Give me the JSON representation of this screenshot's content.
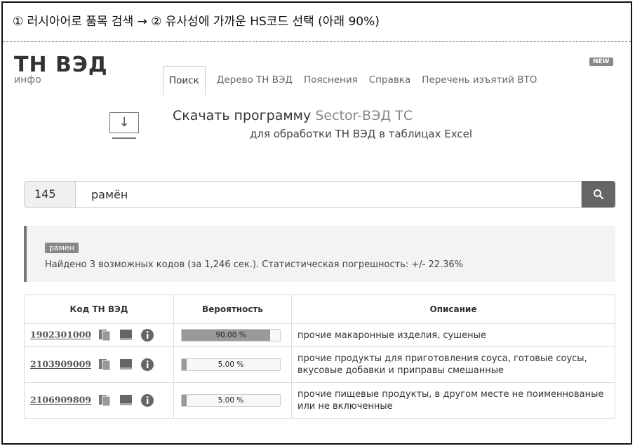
{
  "caption": "① 러시아어로 품목 검색 → ② 유사성에 가까운 HS코드 선택 (아래 90%)",
  "logo": {
    "main": "ТН ВЭД",
    "sub": "инфо"
  },
  "nav": {
    "tabs": [
      "Поиск",
      "Дерево ТН ВЭД",
      "Пояснения",
      "Справка",
      "Перечень изъятий ВТО"
    ],
    "new_badge": "NEW"
  },
  "promo": {
    "line1_prefix": "Скачать программу ",
    "line1_accent": "Sector-ВЭД ТС",
    "line2": "для обработки ТН ВЭД в таблицах Excel",
    "icon": "download-arrow"
  },
  "search": {
    "code": "145",
    "query": "рамён",
    "button_icon": "search-icon"
  },
  "result": {
    "tag": "рамен",
    "summary": "Найдено 3 возможных кодов (за 1,246 сек.). Статистическая погрешность: +/- 22.36%"
  },
  "table": {
    "headers": [
      "Код ТН ВЭД",
      "Вероятность",
      "Описание"
    ],
    "rows": [
      {
        "code": "1902301000",
        "probability_label": "90.00 %",
        "probability": 0.9,
        "description": "прочие макаронные изделия, сушеные"
      },
      {
        "code": "2103909009",
        "probability_label": "5.00 %",
        "probability": 0.05,
        "description": "прочие продукты для приготовления соуса, готовые соусы, вкусовые добавки и приправы смешанные"
      },
      {
        "code": "2106909809",
        "probability_label": "5.00 %",
        "probability": 0.05,
        "description": "прочие пищевые продукты, в другом месте не поименнованые или не включенные"
      }
    ]
  },
  "colors": {
    "accent_gray": "#888888",
    "button": "#666666",
    "bar_fill": "#999999"
  }
}
